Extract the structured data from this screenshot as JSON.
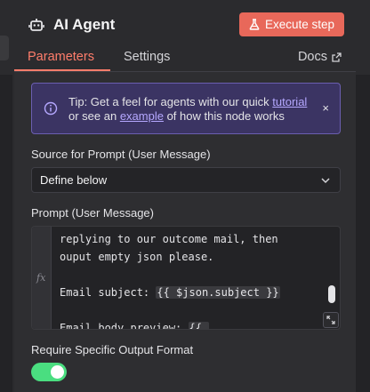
{
  "header": {
    "title": "AI Agent",
    "title_icon": "robot-icon",
    "execute_label": "Execute step",
    "execute_icon": "flask-icon",
    "accent_color": "#e8685a"
  },
  "tabs": {
    "parameters_label": "Parameters",
    "settings_label": "Settings",
    "docs_label": "Docs",
    "active": "Parameters"
  },
  "tip": {
    "text_1": "Tip: Get a feel for agents with our quick ",
    "link_1": "tutorial",
    "text_2": " or see an ",
    "link_2": "example",
    "text_3": " of how this node works",
    "close_label": "×"
  },
  "source_field": {
    "label": "Source for Prompt (User Message)",
    "value": "Define below"
  },
  "prompt_field": {
    "label": "Prompt (User Message)",
    "gutter_label": "fx",
    "lines": [
      "replying to our outcome mail, then",
      "ouput empty json please.",
      "",
      "Email subject: {{ $json.subject }}",
      "",
      "Email body preview: {{ "
    ]
  },
  "output_format": {
    "label": "Require Specific Output Format",
    "enabled": true,
    "toggle_color": "#4ade80"
  }
}
